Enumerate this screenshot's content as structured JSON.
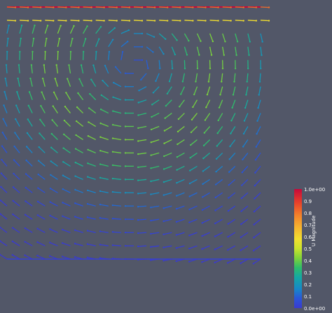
{
  "view": {
    "background_color": "#525768"
  },
  "colorbar": {
    "title": "U Magnitude",
    "ticks": [
      "1.0e+00",
      "0.9",
      "0.8",
      "0.7",
      "0.6",
      "0.5",
      "0.4",
      "0.3",
      "0.2",
      "0.1",
      "0.0e+00"
    ],
    "range": [
      0,
      1
    ],
    "colors": [
      "#3a3ad0",
      "#2a55d8",
      "#1788c9",
      "#15a8a3",
      "#2fbd6a",
      "#7fd23a",
      "#c9e32d",
      "#f2e02f",
      "#f5b32f",
      "#f2812a",
      "#e8442a",
      "#c7093a"
    ]
  },
  "field": {
    "description_type": "lid-driven cavity velocity glyphs",
    "grid_columns": 21,
    "grid_rows": 20
  }
}
